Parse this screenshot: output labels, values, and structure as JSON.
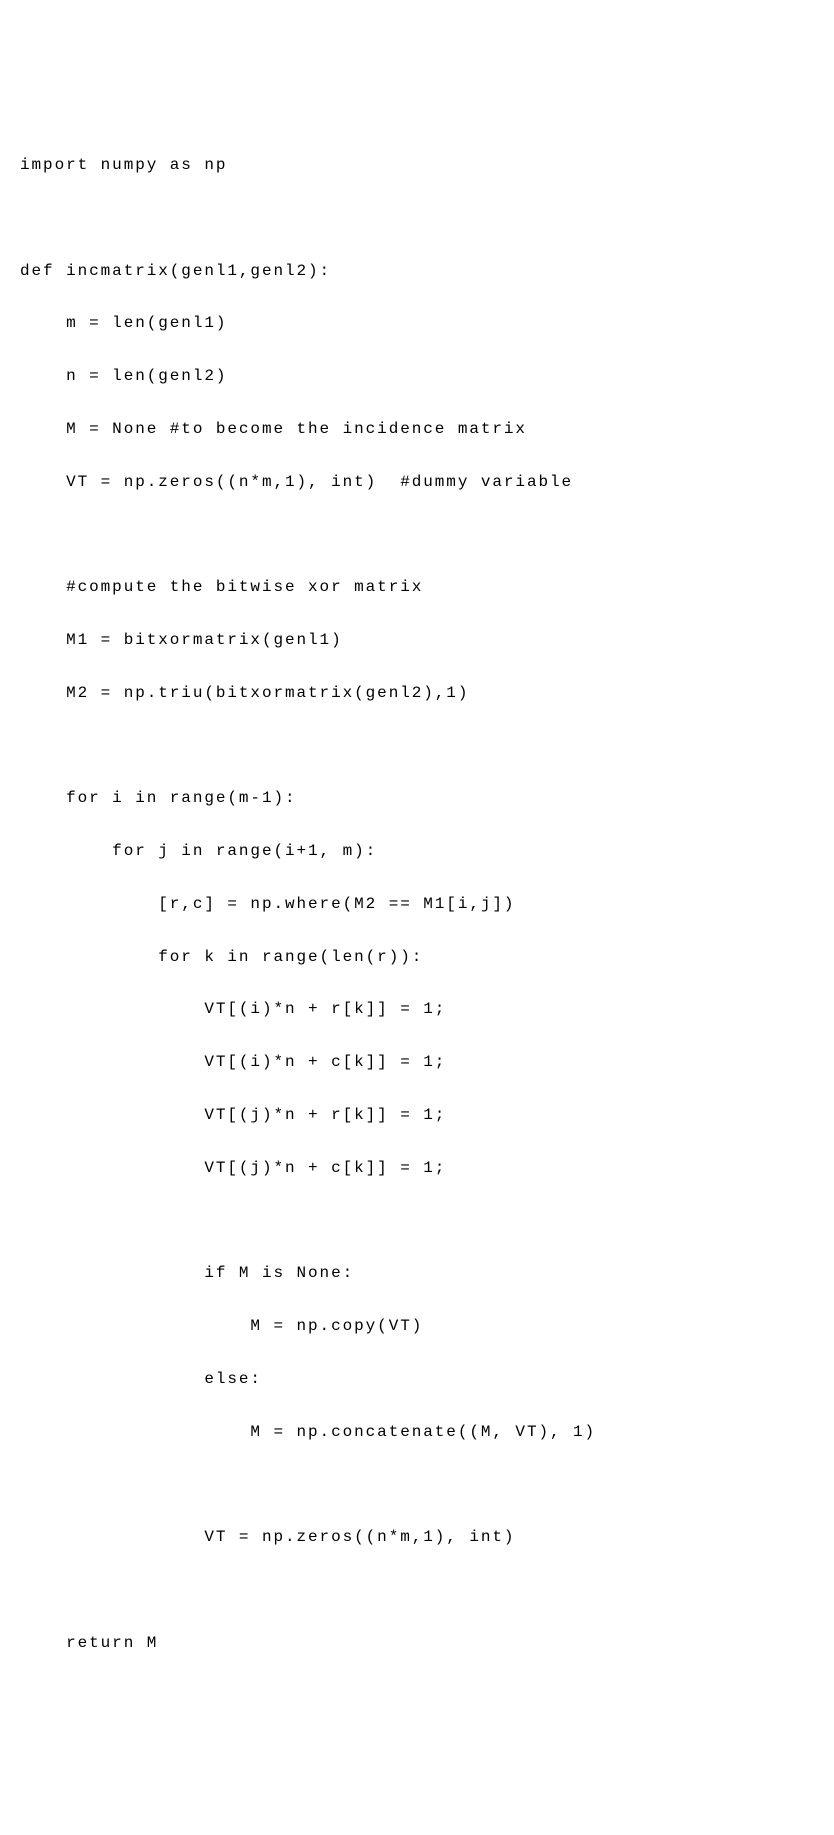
{
  "code": {
    "lines": [
      "import numpy as np",
      "",
      "def incmatrix(genl1,genl2):",
      "    m = len(genl1)",
      "    n = len(genl2)",
      "    M = None #to become the incidence matrix",
      "    VT = np.zeros((n*m,1), int)  #dummy variable",
      "",
      "    #compute the bitwise xor matrix",
      "    M1 = bitxormatrix(genl1)",
      "    M2 = np.triu(bitxormatrix(genl2),1)",
      "",
      "    for i in range(m-1):",
      "        for j in range(i+1, m):",
      "            [r,c] = np.where(M2 == M1[i,j])",
      "            for k in range(len(r)):",
      "                VT[(i)*n + r[k]] = 1;",
      "                VT[(i)*n + c[k]] = 1;",
      "                VT[(j)*n + r[k]] = 1;",
      "                VT[(j)*n + c[k]] = 1;",
      "",
      "                if M is None:",
      "                    M = np.copy(VT)",
      "                else:",
      "                    M = np.concatenate((M, VT), 1)",
      "",
      "                VT = np.zeros((n*m,1), int)",
      "",
      "    return M"
    ]
  }
}
